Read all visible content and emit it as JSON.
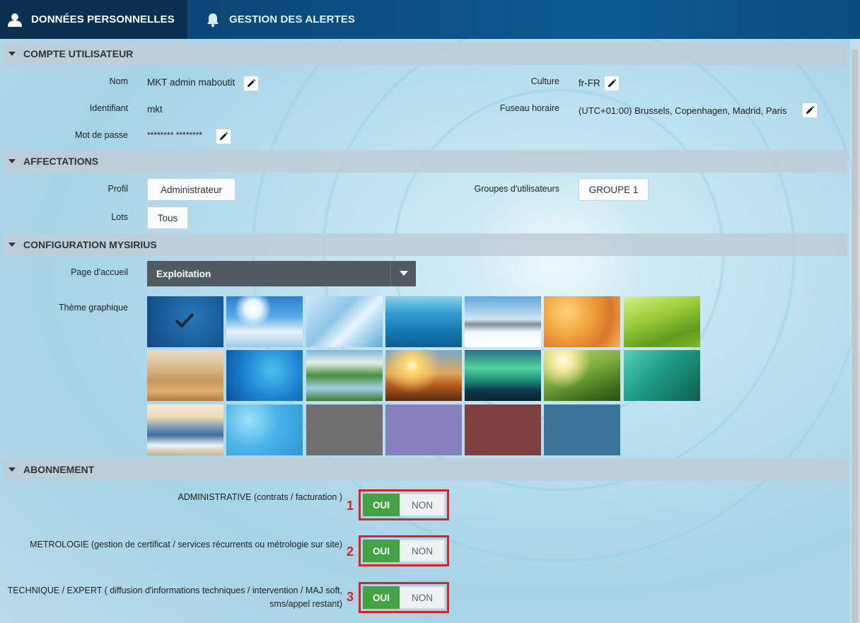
{
  "tabs": [
    {
      "label": "DONNÉES PERSONNELLES",
      "icon": "user-icon"
    },
    {
      "label": "GESTION DES ALERTES",
      "icon": "bell-icon"
    }
  ],
  "compte": {
    "header": "COMPTE UTILISATEUR",
    "nom_label": "Nom",
    "nom_value": "MKT admin maboutit",
    "identifiant_label": "Identifiant",
    "identifiant_value": "mkt",
    "mdp_label": "Mot de passe",
    "mdp_value": "******** ********",
    "culture_label": "Culture",
    "culture_value": "fr-FR",
    "fuseau_label": "Fuseau horaire",
    "fuseau_value": "(UTC+01:00) Brussels, Copenhagen, Madrid, Paris"
  },
  "affectations": {
    "header": "AFFECTATIONS",
    "profil_label": "Profil",
    "profil_value": "Administrateur",
    "lots_label": "Lots",
    "lots_value": "Tous",
    "groupes_label": "Groupes d'utilisateurs",
    "groupes_value": "GROUPE 1"
  },
  "config": {
    "header": "CONFIGURATION MYSIRIUS",
    "accueil_label": "Page d'accueil",
    "accueil_value": "Exploitation",
    "theme_label": "Thème graphique",
    "themes": [
      {
        "name": "blue-abstract",
        "selected": true
      },
      {
        "name": "sky-clouds"
      },
      {
        "name": "ice"
      },
      {
        "name": "underwater"
      },
      {
        "name": "snow-landscape"
      },
      {
        "name": "autumn-leaves"
      },
      {
        "name": "grass"
      },
      {
        "name": "desert-dunes"
      },
      {
        "name": "blue-plexus"
      },
      {
        "name": "green-valley"
      },
      {
        "name": "sunset"
      },
      {
        "name": "aurora"
      },
      {
        "name": "sprout"
      },
      {
        "name": "water-drops"
      },
      {
        "name": "mountain-mist"
      },
      {
        "name": "blue-texture"
      },
      {
        "name": "solid-grey"
      },
      {
        "name": "solid-lavender"
      },
      {
        "name": "solid-burgundy"
      },
      {
        "name": "solid-steel-blue"
      }
    ]
  },
  "abonnement": {
    "header": "ABONNEMENT",
    "items": [
      {
        "label": "ADMINISTRATIVE (contrats / facturation )",
        "number": "1",
        "oui": "OUI",
        "non": "NON"
      },
      {
        "label": "METROLOGIE (gestion de certificat / services récurrents ou métrologie sur site)",
        "number": "2",
        "oui": "OUI",
        "non": "NON"
      },
      {
        "label_line1": "TECHNIQUE / EXPERT ( diffusion d'informations techniques / intervention / MAJ soft,",
        "label_line2": "sms/appel restant)",
        "number": "3",
        "oui": "OUI",
        "non": "NON"
      }
    ]
  },
  "colors": {
    "accent_green": "#43a244",
    "highlight_red": "#d8232a",
    "topbar": "#0b3d67"
  }
}
